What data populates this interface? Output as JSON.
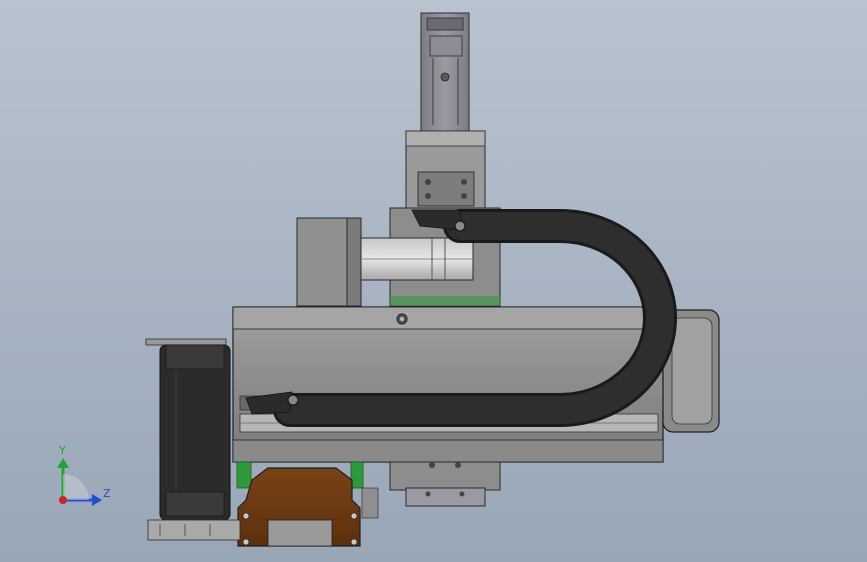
{
  "axes_triad": {
    "y_label": "Y",
    "z_label": "Z"
  },
  "colors": {
    "background_top": "#b9c3cf",
    "background_bottom": "#98a6b6",
    "housing": "#8e8e8e",
    "housing_dark": "#6f6f6f",
    "cable_chain": "#2b2b2b",
    "bracket_brown": "#6e3a12",
    "green_part": "#2f9a3a",
    "axis_x_red": "#d42020",
    "axis_y_green": "#22a33a",
    "axis_z_blue": "#1f4fd6"
  }
}
